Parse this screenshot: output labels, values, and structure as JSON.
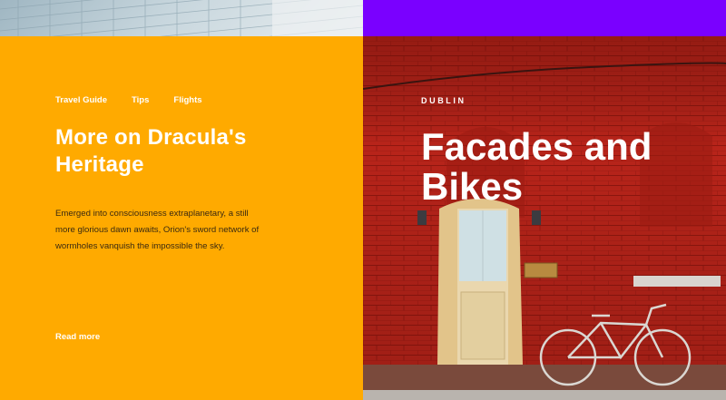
{
  "nav": {
    "items": [
      {
        "label": "Travel Guide"
      },
      {
        "label": "Tips"
      },
      {
        "label": "Flights"
      }
    ]
  },
  "left_article": {
    "title": "More on Dracula's Heritage",
    "body": "Emerged into consciousness extraplanetary, a still more glorious dawn awaits, Orion's sword network of wormholes vanquish the impossible the sky.",
    "read_more": "Read more"
  },
  "right_feature": {
    "kicker": "DUBLIN",
    "title": "Facades and Bikes"
  },
  "colors": {
    "left_panel": "#ffaa00",
    "top_right_strip": "#7a00ff",
    "brick": "#b52016",
    "text_light": "#ffffff"
  }
}
